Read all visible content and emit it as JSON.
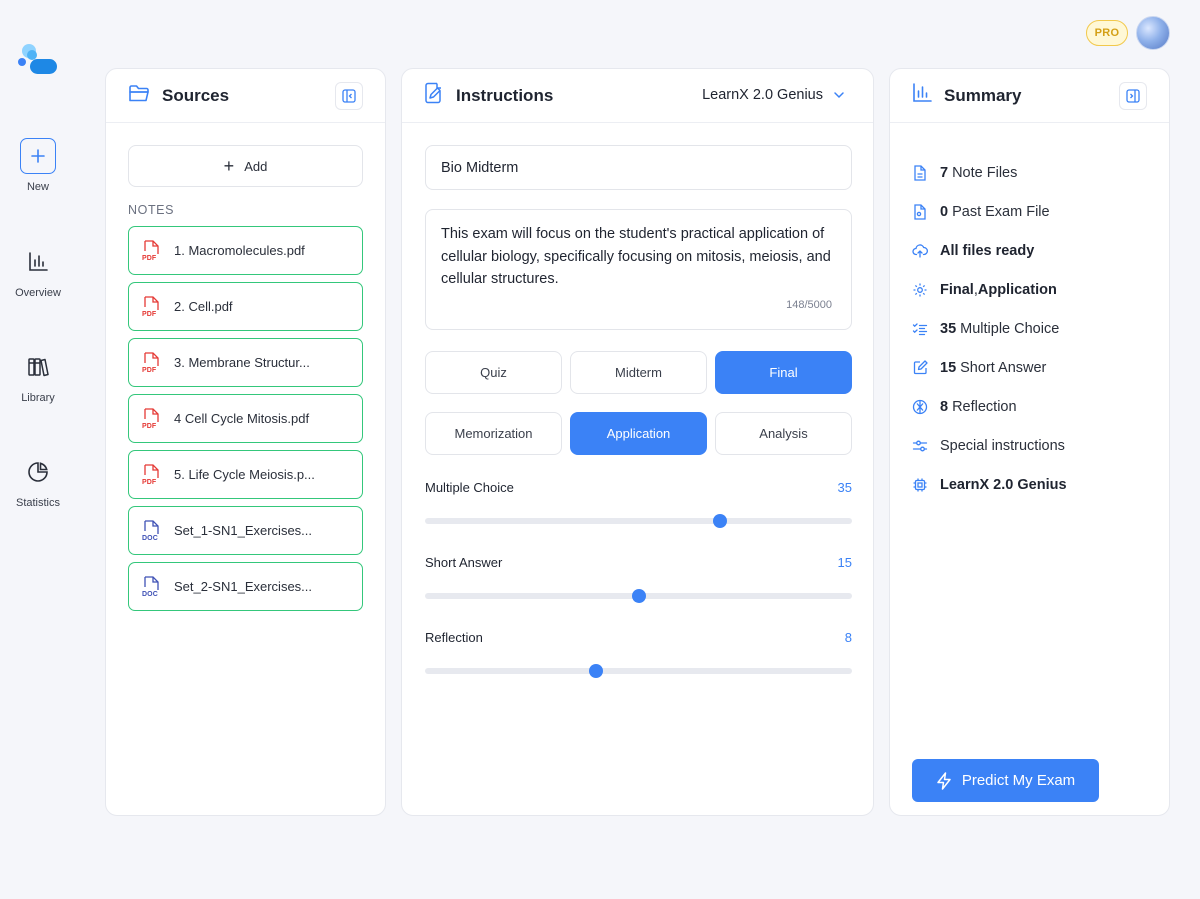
{
  "rail": {
    "items": [
      {
        "label": "New",
        "icon": "plus-icon"
      },
      {
        "label": "Overview",
        "icon": "bar-chart-icon"
      },
      {
        "label": "Library",
        "icon": "books-icon"
      },
      {
        "label": "Statistics",
        "icon": "pie-chart-icon"
      }
    ]
  },
  "top": {
    "badge": "PRO"
  },
  "sources": {
    "title": "Sources",
    "add_label": "Add",
    "notes_label": "NOTES",
    "files": [
      {
        "name": "1. Macromolecules.pdf",
        "type": "PDF"
      },
      {
        "name": "2. Cell.pdf",
        "type": "PDF"
      },
      {
        "name": "3. Membrane Structur...",
        "type": "PDF"
      },
      {
        "name": "4 Cell Cycle Mitosis.pdf",
        "type": "PDF"
      },
      {
        "name": "5. Life Cycle Meiosis.p...",
        "type": "PDF"
      },
      {
        "name": "Set_1-SN1_Exercises...",
        "type": "DOC"
      },
      {
        "name": "Set_2-SN1_Exercises...",
        "type": "DOC"
      }
    ]
  },
  "instructions": {
    "title": "Instructions",
    "model": "LearnX 2.0 Genius",
    "exam_title": "Bio Midterm",
    "description": "This exam will focus on the student's practical application of cellular biology, specifically focusing on mitosis, meiosis, and cellular structures.",
    "char_count": "148/5000",
    "exam_types": [
      "Quiz",
      "Midterm",
      "Final"
    ],
    "exam_type_selected": "Final",
    "skills": [
      "Memorization",
      "Application",
      "Analysis"
    ],
    "skill_selected": "Application",
    "sliders": [
      {
        "label": "Multiple Choice",
        "value": "35",
        "level": 0.69
      },
      {
        "label": "Short Answer",
        "value": "15",
        "level": 0.5
      },
      {
        "label": "Reflection",
        "value": "8",
        "level": 0.4
      }
    ]
  },
  "summary": {
    "title": "Summary",
    "items": {
      "note_files": {
        "bold": "7",
        "text": "Note Files"
      },
      "past_exam": {
        "bold": "0",
        "text": "Past Exam File"
      },
      "files_ready": {
        "bold": "All files ready",
        "text": ""
      },
      "exam_config": {
        "bold": "Final",
        "text": ", ",
        "bold2": "Application"
      },
      "mc": {
        "bold": "35",
        "text": "Multiple Choice"
      },
      "sa": {
        "bold": "15",
        "text": "Short Answer"
      },
      "refl": {
        "bold": "8",
        "text": "Reflection"
      },
      "special": {
        "bold": "",
        "text": "Special instructions"
      },
      "model": {
        "bold": "LearnX 2.0 Genius",
        "text": ""
      }
    },
    "predict_label": "Predict My Exam"
  },
  "colors": {
    "accent": "#3b82f6",
    "file_border": "#34c77b",
    "pdf": "#e53935",
    "doc": "#3f51b5"
  }
}
